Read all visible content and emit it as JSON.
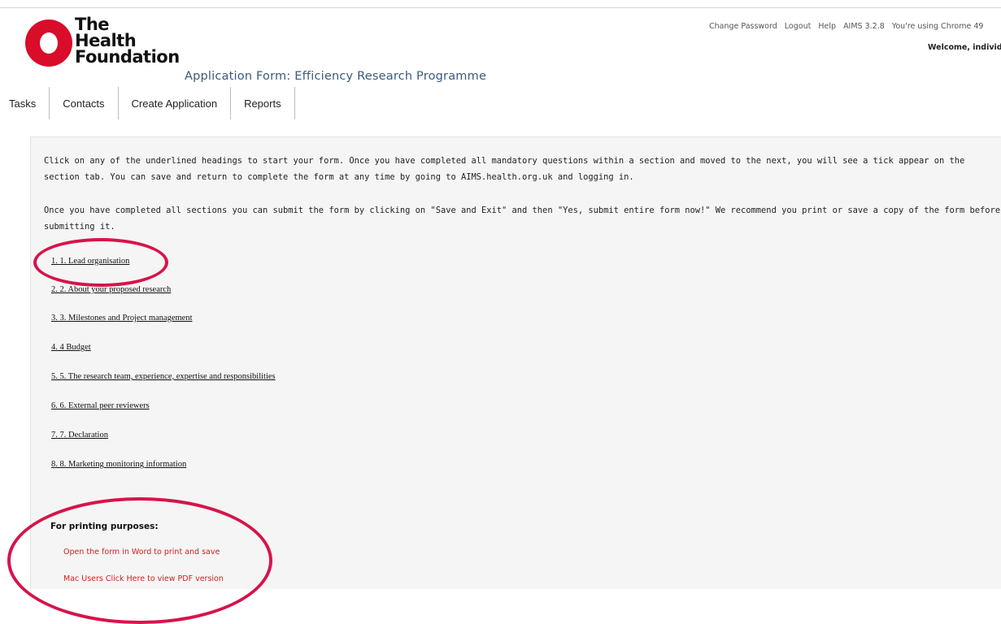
{
  "logo": {
    "line1": "The",
    "line2": "Health",
    "line3": "Foundation"
  },
  "app_title": "Application Form: Efficiency Research Programme",
  "top_links": {
    "change_password": "Change Password",
    "logout": "Logout",
    "help": "Help",
    "version": "AIMS 3.2.8",
    "browser": "You're using Chrome 49",
    "welcome": "Welcome, individu"
  },
  "nav": [
    "Tasks",
    "Contacts",
    "Create Application",
    "Reports"
  ],
  "intro": {
    "p1": "Click on any of the underlined headings to start your form. Once you have completed all mandatory questions within a section and moved to the next, you will see a tick appear on the section tab. You can save and return to complete the form at any time by going to AIMS.health.org.uk and logging in.",
    "p2": "Once you have completed all sections you can submit the form by clicking on \"Save and Exit\" and then \"Yes, submit entire form now!\" We recommend you print or save a copy of the form before submitting it."
  },
  "sections": [
    "1. 1. Lead organisation",
    "2. 2. About your proposed research",
    "3. 3. Milestones and Project management",
    "4. 4 Budget",
    "5. 5. The research team, experience, expertise and responsibilities",
    "6. 6. External peer reviewers",
    "7. 7. Declaration",
    "8. 8. Marketing monitoring information"
  ],
  "printing": {
    "heading": "For printing purposes:",
    "word_link": "Open the form in Word to print and save",
    "pdf_link": "Mac Users Click Here to view PDF version"
  },
  "colors": {
    "brand_red": "#d90c2a",
    "link_red": "#d32020",
    "annotation": "#d6144a"
  }
}
